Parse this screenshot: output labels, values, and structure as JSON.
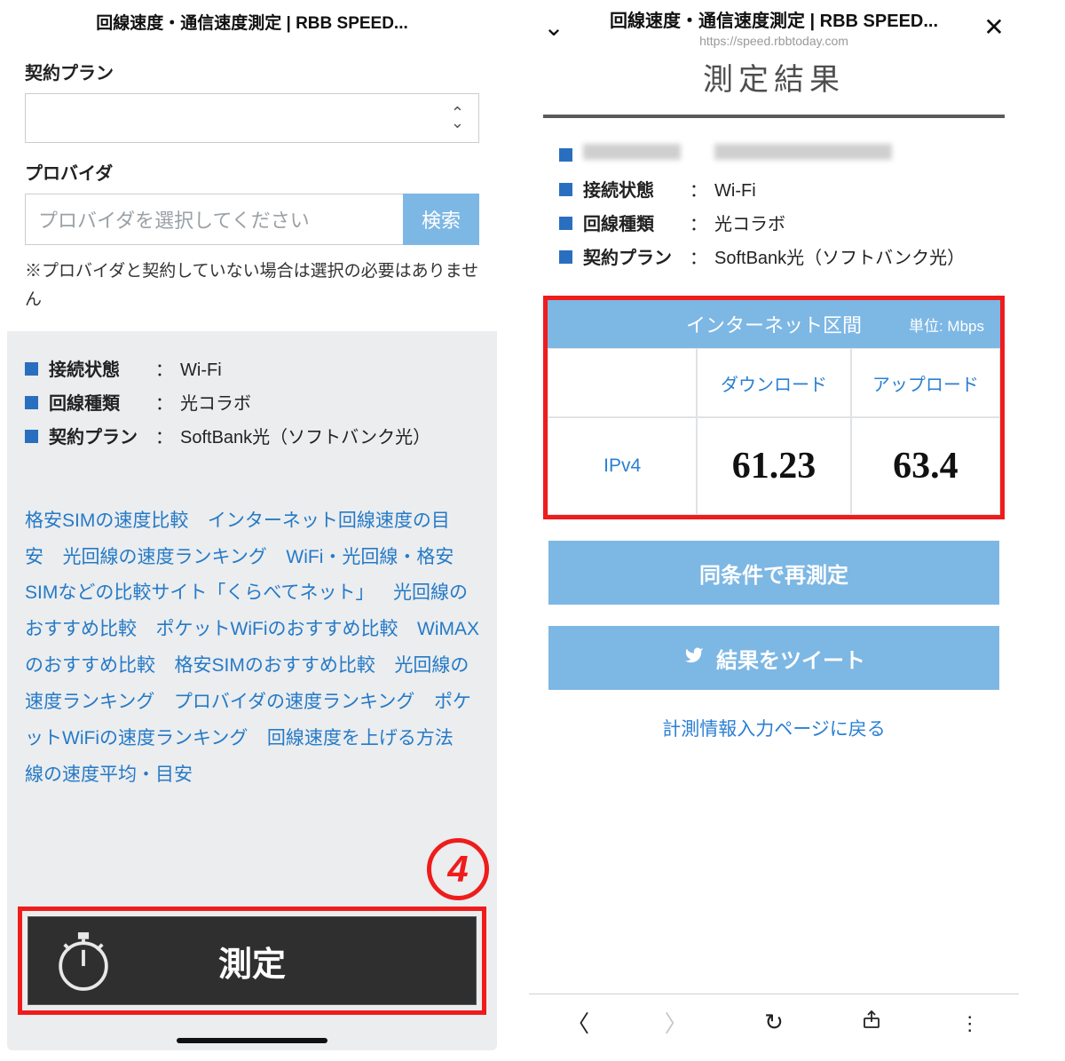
{
  "left": {
    "title": "回線速度・通信速度測定 | RBB SPEED...",
    "plan_label": "契約プラン",
    "provider_label": "プロバイダ",
    "provider_placeholder": "プロバイダを選択してください",
    "search_btn": "検索",
    "note": "※プロバイダと契約していない場合は選択の必要はありません",
    "kv": [
      {
        "key": "接続状態",
        "val": "Wi-Fi"
      },
      {
        "key": "回線種類",
        "val": "光コラボ"
      },
      {
        "key": "契約プラン",
        "val": "SoftBank光（ソフトバンク光）"
      }
    ],
    "links": [
      "格安SIMの速度比較",
      "インターネット回線速度の目安",
      "光回線の速度ランキング",
      "WiFi・光回線・格安SIMなどの比較サイト「くらべてネット」",
      "光回線のおすすめ比較",
      "ポケットWiFiのおすすめ比較",
      "WiMAXのおすすめ比較",
      "格安SIMのおすすめ比較",
      "光回線の速度ランキング",
      "プロバイダの速度ランキング",
      "ポケットWiFiの速度ランキング",
      "回線速度を上げる方法",
      "線の速度平均・目安"
    ],
    "measure_btn": "測定",
    "step_badge": "4"
  },
  "right": {
    "title": "回線速度・通信速度測定 | RBB SPEED...",
    "url": "https://speed.rbbtoday.com",
    "result_heading": "測定結果",
    "kv": [
      {
        "key": "接続状態",
        "val": "Wi-Fi"
      },
      {
        "key": "回線種類",
        "val": "光コラボ"
      },
      {
        "key": "契約プラン",
        "val": "SoftBank光（ソフトバンク光）"
      }
    ],
    "speed": {
      "section": "インターネット区間",
      "unit": "単位: Mbps",
      "col_dl": "ダウンロード",
      "col_ul": "アップロード",
      "row_label": "IPv4",
      "dl": "61.23",
      "ul": "63.4"
    },
    "btn_remeasure": "同条件で再測定",
    "btn_tweet": "結果をツイート",
    "back_link": "計測情報入力ページに戻る"
  }
}
